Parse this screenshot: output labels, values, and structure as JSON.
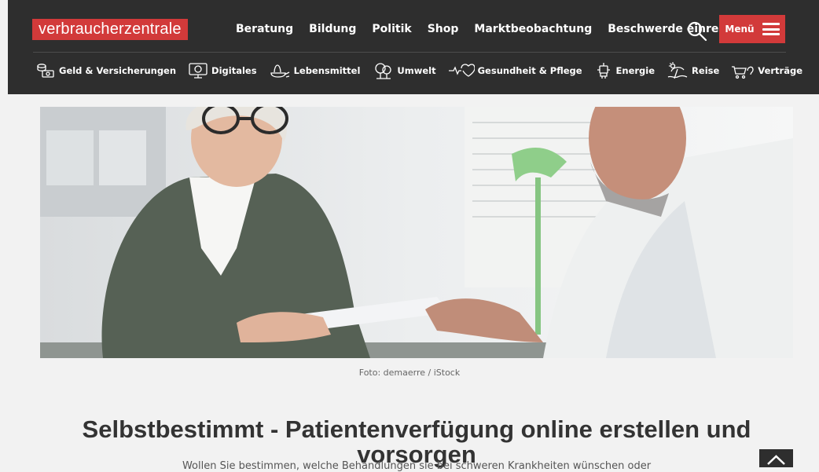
{
  "header": {
    "logo_text": "verbraucherzentrale",
    "nav": [
      "Beratung",
      "Bildung",
      "Politik",
      "Shop",
      "Marktbeobachtung",
      "Beschwerde einreichen"
    ],
    "menu_label": "Menü"
  },
  "categories": [
    {
      "label": "Geld & Versicherungen",
      "icon": "money-icon"
    },
    {
      "label": "Digitales",
      "icon": "digital-icon"
    },
    {
      "label": "Lebensmittel",
      "icon": "food-icon"
    },
    {
      "label": "Umwelt",
      "icon": "environment-icon"
    },
    {
      "label": "Gesundheit & Pflege",
      "icon": "health-icon"
    },
    {
      "label": "Energie",
      "icon": "energy-icon"
    },
    {
      "label": "Reise",
      "icon": "travel-icon"
    },
    {
      "label": "Verträge",
      "icon": "cart-icon"
    }
  ],
  "hero": {
    "caption": "Foto: demaerre / iStock"
  },
  "article": {
    "title": "Selbstbestimmt - Patientenverfügung online erstellen und vorsorgen",
    "intro": "Wollen Sie bestimmen, welche Behandlungen sie bei schweren Krankheiten wünschen oder"
  },
  "colors": {
    "brand": "#d23a3a",
    "header_bg": "#2e2e2e"
  }
}
